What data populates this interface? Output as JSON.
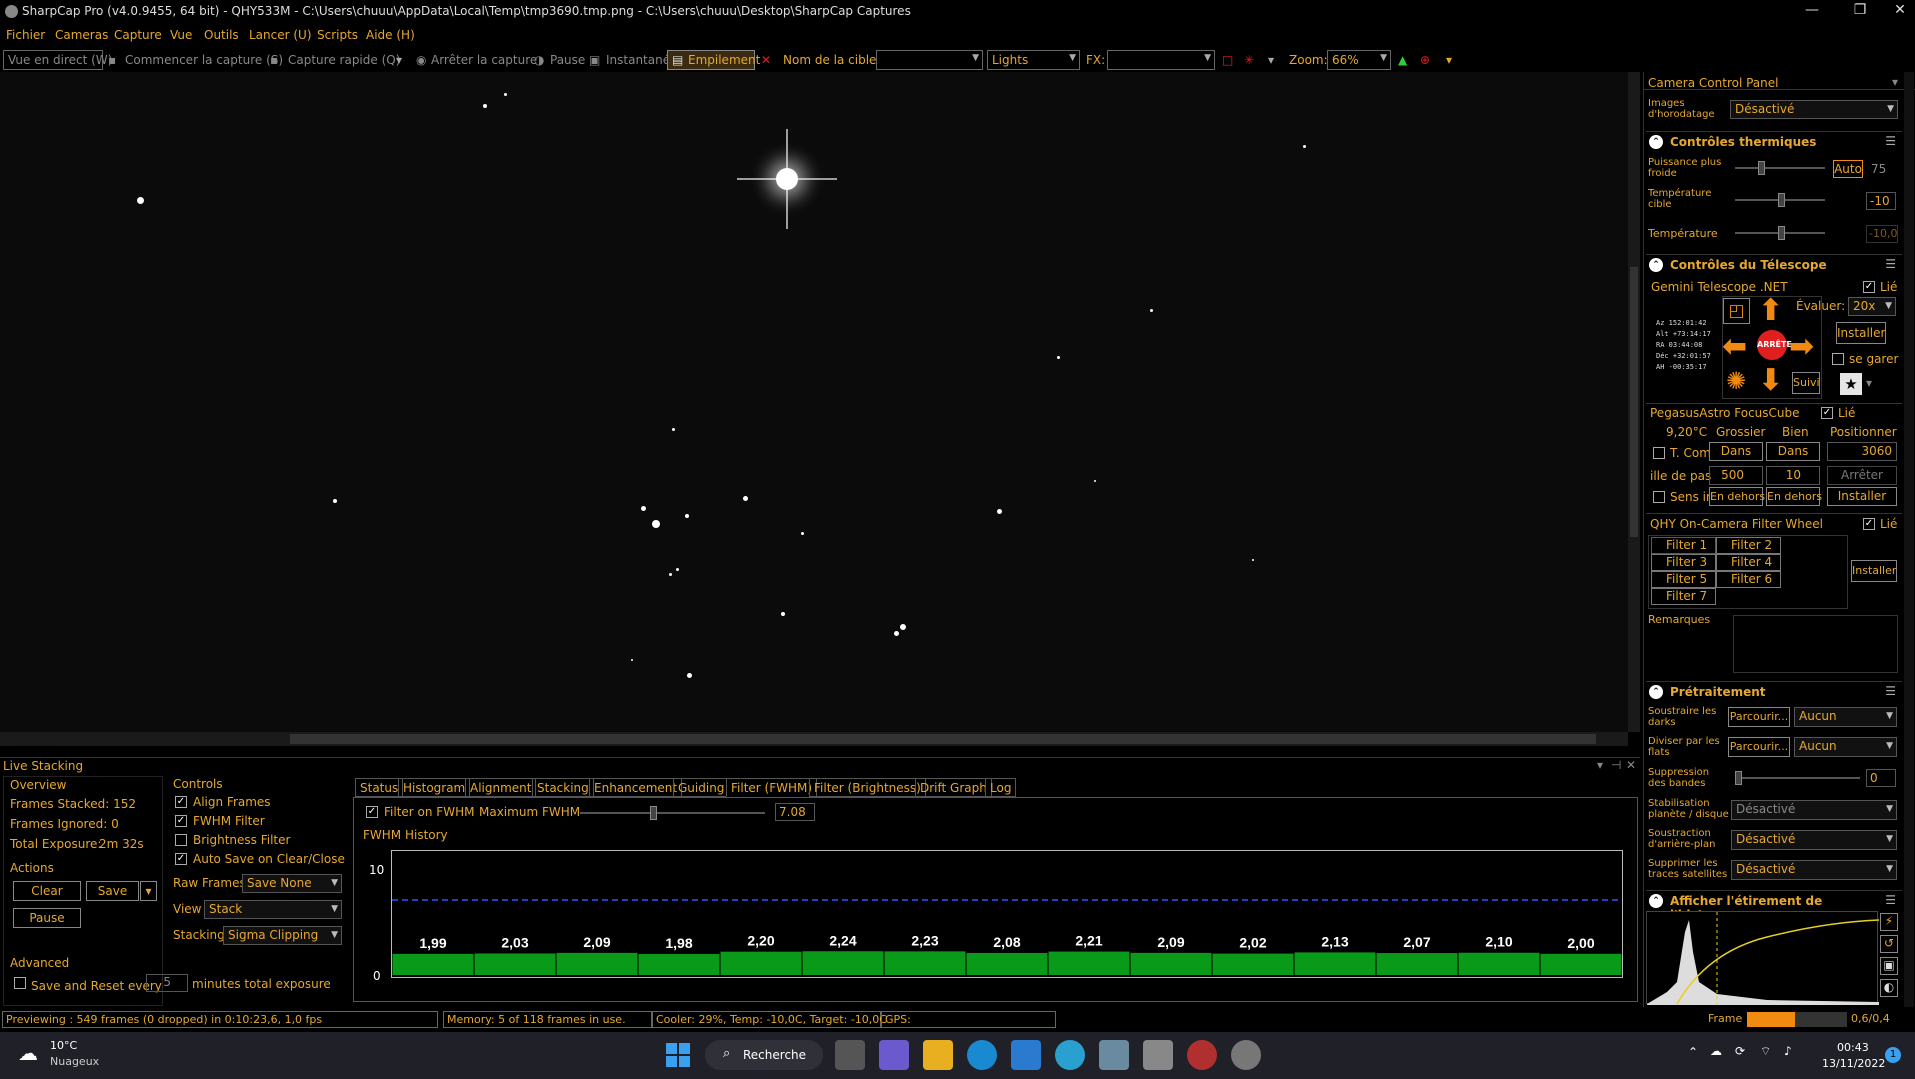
{
  "window": {
    "title": "SharpCap Pro (v4.0.9455, 64 bit) - QHY533M - C:\\Users\\chuuu\\AppData\\Local\\Temp\\tmp3690.tmp.png - C:\\Users\\chuuu\\Desktop\\SharpCap Captures"
  },
  "menu": [
    "Fichier",
    "Cameras",
    "Capture",
    "Vue",
    "Outils",
    "Lancer (U)",
    "Scripts",
    "Aide (H)"
  ],
  "toolbar": {
    "live_view": "Vue en direct (W)",
    "start_capture": "Commencer la capture (S)",
    "quick_capture": "Capture rapide (Q)",
    "stop_capture": "Arrêter la capture",
    "pause": "Pause",
    "snapshot": "Instantané",
    "stacking": "Empilement",
    "target_label": "Nom de la cible:",
    "target_value": "",
    "frame_type": "Lights",
    "fx_label": "FX:",
    "fx_value": "",
    "zoom_label": "Zoom:",
    "zoom_value": "66%"
  },
  "live_stacking": {
    "title": "Live Stacking",
    "overview": {
      "heading": "Overview",
      "frames_stacked": "Frames Stacked: 152",
      "frames_ignored": "Frames Ignored: 0",
      "total_exposure_label": "Total Exposure:",
      "total_exposure_value": "2m 32s"
    },
    "actions": {
      "heading": "Actions",
      "clear": "Clear",
      "save": "Save",
      "pause": "Pause"
    },
    "controls": {
      "heading": "Controls",
      "align": "Align Frames",
      "fwhm": "FWHM Filter",
      "brightness": "Brightness Filter",
      "autosave": "Auto Save on Clear/Close",
      "raw_frames_label": "Raw Frames",
      "raw_frames_value": "Save None",
      "view_label": "View",
      "view_value": "Stack",
      "stacking_label": "Stacking",
      "stacking_value": "Sigma Clipping"
    },
    "advanced": {
      "heading": "Advanced",
      "save_reset": "Save and Reset every",
      "minutes_value": "5",
      "minutes_suffix": "minutes total exposure"
    },
    "tabs": [
      "Status",
      "Histogram",
      "Alignment",
      "Stacking",
      "Enhancement",
      "Guiding",
      "Filter (FWHM)",
      "Filter (Brightness)",
      "Drift Graph",
      "Log"
    ],
    "fwhm": {
      "filter_on": "Filter on FWHM",
      "max_label": "Maximum FWHM",
      "max_value": "7.08",
      "history_label": "FWHM History",
      "y_top": "10",
      "y_bottom": "0"
    }
  },
  "chart_data": {
    "type": "bar",
    "title": "FWHM History",
    "values": [
      1.99,
      2.03,
      2.09,
      1.98,
      2.2,
      2.24,
      2.23,
      2.08,
      2.21,
      2.09,
      2.02,
      2.13,
      2.07,
      2.1,
      2.0
    ],
    "labels": [
      "1,99",
      "2,03",
      "2,09",
      "1,98",
      "2,20",
      "2,24",
      "2,23",
      "2,08",
      "2,21",
      "2,09",
      "2,02",
      "2,13",
      "2,07",
      "2,10",
      "2,00"
    ],
    "ylim": [
      0,
      10
    ],
    "threshold": 7.08,
    "bar_color": "#0a9a1a",
    "threshold_color": "#3050ff"
  },
  "status": {
    "preview": "Previewing : 549 frames (0 dropped) in 0:10:23,6, 1,0 fps",
    "memory": "Memory: 5 of 118 frames in use.",
    "cooler": "Cooler: 29%, Temp: -10,0C, Target: -10,0C",
    "gps": "GPS:",
    "frame_label": "Frame :",
    "frame_value": "0,6/0,4"
  },
  "ccp": {
    "title": "Camera Control Panel",
    "timestamp_label": "Images d'horodatage",
    "timestamp_value": "Désactivé",
    "thermal": {
      "title": "Contrôles thermiques",
      "power_label": "Puissance plus froide",
      "auto": "Auto",
      "power_value": "75",
      "target_label": "Température cible",
      "target_value": "-10",
      "temp_label": "Température",
      "temp_value": "-10,0"
    },
    "telescope": {
      "title": "Contrôles du Télescope",
      "name": "Gemini Telescope .NET",
      "linked": "Lié",
      "rate_label": "Évaluer:",
      "rate_value": "20x",
      "setup": "Installer",
      "park": "se garer",
      "stop": "ARRÊTE",
      "track": "Suivi",
      "coords": [
        "Az   152:01:42",
        "Alt +73:14:17",
        "RA   03:44:08",
        "Déc +32:01:57",
        "AH  -00:35:17"
      ]
    },
    "focuser": {
      "name": "PegasusAstro FocusCube",
      "linked": "Lié",
      "temp": "9,20°C",
      "coarse": "Grossier",
      "fine": "Bien",
      "position_label": "Positionner",
      "tcomp": "T. Com",
      "in": "Dans",
      "position_value": "3060",
      "step_label": "ille de pas",
      "coarse_step": "500",
      "fine_step": "10",
      "stop": "Arrêter",
      "reverse": "Sens ir",
      "out": "En dehors",
      "setup": "Installer"
    },
    "filterwheel": {
      "name": "QHY On-Camera Filter Wheel",
      "linked": "Lié",
      "filters": [
        "Filter 1",
        "Filter 2",
        "Filter 3",
        "Filter 4",
        "Filter 5",
        "Filter 6",
        "Filter 7"
      ],
      "setup": "Installer",
      "notes_label": "Remarques"
    },
    "preprocessing": {
      "title": "Prétraitement",
      "darks_label": "Soustraire les darks",
      "flats_label": "Diviser par les flats",
      "browse": "Parcourir...",
      "none": "Aucun",
      "banding_label": "Suppression des bandes",
      "banding_value": "0",
      "stabilization_label": "Stabilisation planète / disque",
      "stabilization_value": "Désactivé",
      "background_label": "Soustraction d'arrière-plan",
      "background_value": "Désactivé",
      "satellite_label": "Supprimer les traces satellites",
      "satellite_value": "Désactivé"
    },
    "histogram": {
      "title": "Afficher l'étirement de l'histogramme"
    }
  },
  "taskbar": {
    "weather_temp": "10°C",
    "weather_desc": "Nuageux",
    "search": "Recherche",
    "time": "00:43",
    "date": "13/11/2022",
    "notif": "1"
  }
}
